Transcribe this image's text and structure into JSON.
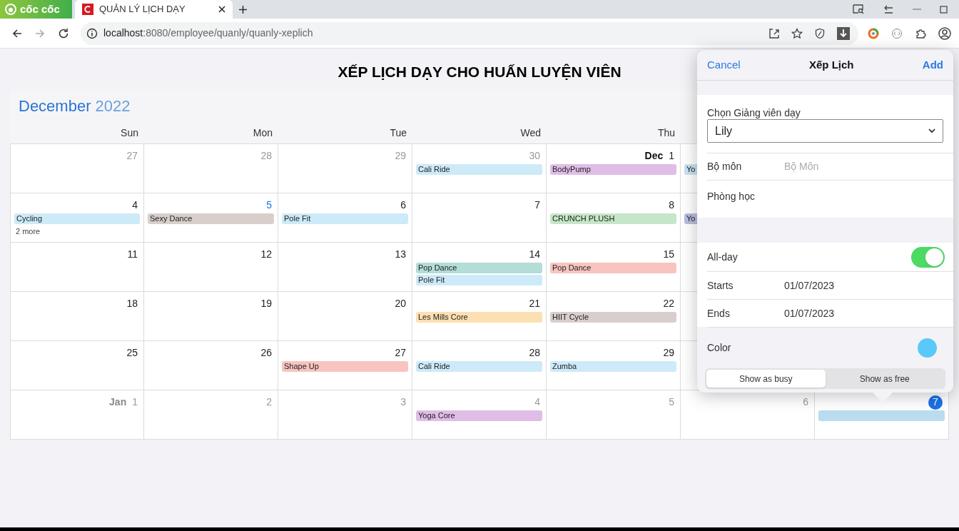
{
  "browser": {
    "brand": "cốc cốc",
    "tabs": [
      {
        "title": "QUẢN LÝ LỊCH DẠY",
        "selected": true
      }
    ],
    "url_host": "localhost",
    "url_path": ":8080/employee/quanly/quanly-xeplich"
  },
  "page_title": "XẾP LỊCH DẠY CHO HUẤN LUYỆN VIÊN",
  "calendar": {
    "month": "December",
    "year": "2022",
    "weekdays": [
      "Sun",
      "Mon",
      "Tue",
      "Wed",
      "Thu"
    ],
    "weeks": [
      [
        {
          "label": "27",
          "muted": true
        },
        {
          "label": "28",
          "muted": true
        },
        {
          "label": "29",
          "muted": true
        },
        {
          "label": "30",
          "muted": true,
          "events": [
            {
              "title": "Cali Ride",
              "color": "#cdeaf9"
            }
          ]
        },
        {
          "label": "1",
          "month": "Dec",
          "events": [
            {
              "title": "BodyPump",
              "color": "#e0bde6"
            }
          ]
        },
        {
          "events": [
            {
              "title": "Yo",
              "color": "#c9e2f2"
            }
          ]
        }
      ],
      [
        {
          "label": "4",
          "events": [
            {
              "title": "Cycling",
              "color": "#cdeaf9"
            }
          ],
          "more": "2 more"
        },
        {
          "label": "5",
          "today": true,
          "events": [
            {
              "title": "Sexy Dance",
              "color": "#d8cfcc"
            }
          ]
        },
        {
          "label": "6",
          "events": [
            {
              "title": "Pole Fit",
              "color": "#cdeaf9"
            }
          ]
        },
        {
          "label": "7"
        },
        {
          "label": "8",
          "events": [
            {
              "title": "CRUNCH PLUSH",
              "color": "#c6e6c9"
            }
          ]
        },
        {
          "events": [
            {
              "title": "Yo",
              "color": "#b9bde0"
            }
          ]
        }
      ],
      [
        {
          "label": "11"
        },
        {
          "label": "12"
        },
        {
          "label": "13"
        },
        {
          "label": "14",
          "events": [
            {
              "title": "Pop Dance",
              "color": "#b3ddd6"
            },
            {
              "title": "Pole Fit",
              "color": "#cdeaf9"
            }
          ]
        },
        {
          "label": "15",
          "events": [
            {
              "title": "Pop Dance",
              "color": "#f8c4bf"
            }
          ]
        }
      ],
      [
        {
          "label": "18"
        },
        {
          "label": "19"
        },
        {
          "label": "20"
        },
        {
          "label": "21",
          "events": [
            {
              "title": "Les Mills Core",
              "color": "#fde0b2"
            }
          ]
        },
        {
          "label": "22",
          "events": [
            {
              "title": "HIIT Cycle",
              "color": "#d8cfcc"
            }
          ]
        }
      ],
      [
        {
          "label": "25"
        },
        {
          "label": "26"
        },
        {
          "label": "27",
          "events": [
            {
              "title": "Shape Up",
              "color": "#f8c4bf"
            }
          ]
        },
        {
          "label": "28",
          "events": [
            {
              "title": "Cali Ride",
              "color": "#cdeaf9"
            }
          ]
        },
        {
          "label": "29",
          "events": [
            {
              "title": "Zumba",
              "color": "#cdeaf9"
            }
          ]
        }
      ],
      [
        {
          "label": "1",
          "month": "Jan",
          "muted": true
        },
        {
          "label": "2",
          "muted": true
        },
        {
          "label": "3",
          "muted": true
        },
        {
          "label": "4",
          "muted": true,
          "events": [
            {
              "title": "Yoga Core",
              "color": "#e0bde6"
            }
          ]
        },
        {
          "label": "5",
          "muted": true
        },
        {
          "label": "6",
          "muted": true
        },
        {
          "label": "7",
          "selected": true,
          "events": [
            {
              "color": "#b9dcef"
            }
          ]
        }
      ]
    ]
  },
  "popover": {
    "cancel": "Cancel",
    "title": "Xếp Lịch",
    "add": "Add",
    "instructor_label": "Chọn Giảng viên dạy",
    "instructor_value": "Lily",
    "subject_label": "Bộ môn",
    "subject_placeholder": "Bộ Môn",
    "room_label": "Phòng học",
    "all_day_label": "All-day",
    "all_day": {
      "on": true
    },
    "starts_label": "Starts",
    "starts": "01/07/2023",
    "ends_label": "Ends",
    "ends": "01/07/2023",
    "color_label": "Color",
    "color": "#5ac8fa",
    "show_as": [
      {
        "label": "Show as busy",
        "selected": true
      },
      {
        "label": "Show as free",
        "selected": false
      }
    ]
  }
}
